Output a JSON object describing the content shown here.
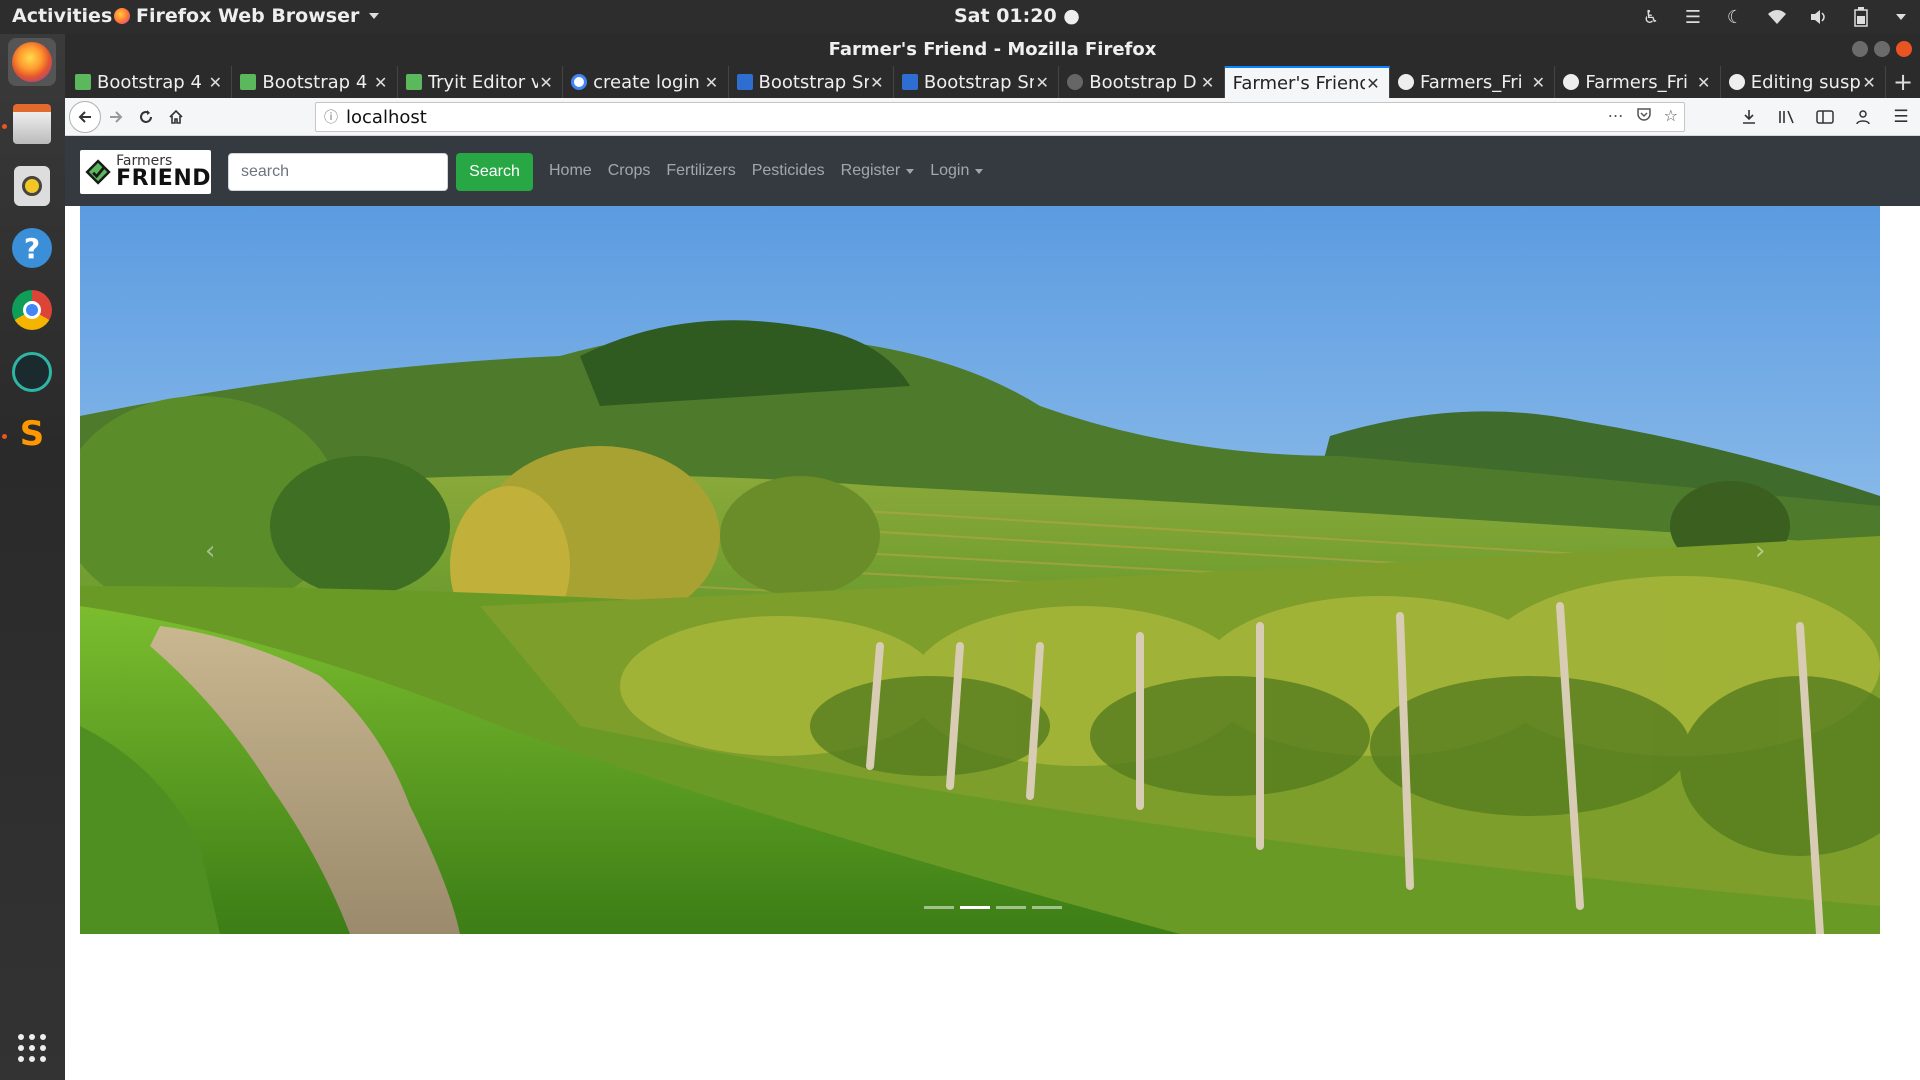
{
  "topbar": {
    "activities": "Activities",
    "app_menu": "Firefox Web Browser",
    "clock": "Sat 01:20",
    "tray_icons": [
      "accessibility-icon",
      "input-menu-icon",
      "night-light-icon",
      "wifi-icon",
      "volume-icon",
      "battery-icon"
    ]
  },
  "dock": {
    "items": [
      "firefox",
      "files",
      "rhythmbox",
      "help",
      "chrome",
      "gitkraken",
      "sublime-text"
    ],
    "apps_grid": "show-applications-icon"
  },
  "window": {
    "title": "Farmer's Friend - Mozilla Firefox"
  },
  "tabs": [
    {
      "title": "Bootstrap 4",
      "icon": "green"
    },
    {
      "title": "Bootstrap 4",
      "icon": "green"
    },
    {
      "title": "Tryit Editor v",
      "icon": "green"
    },
    {
      "title": "create login",
      "icon": "google"
    },
    {
      "title": "Bootstrap Sr",
      "icon": "blue"
    },
    {
      "title": "Bootstrap Sr",
      "icon": "blue"
    },
    {
      "title": "Bootstrap D",
      "icon": "gray"
    },
    {
      "title": "Farmer's Friend",
      "icon": "none",
      "active": true
    },
    {
      "title": "Farmers_Fri",
      "icon": "github"
    },
    {
      "title": "Farmers_Fri",
      "icon": "github"
    },
    {
      "title": "Editing susp",
      "icon": "github"
    }
  ],
  "urlbar": {
    "url": "localhost"
  },
  "site": {
    "brand_small": "Farmers",
    "brand_big": "FRIEND",
    "search_placeholder": "search",
    "search_button": "Search",
    "nav": {
      "home": "Home",
      "crops": "Crops",
      "fertilizers": "Fertilizers",
      "pesticides": "Pesticides",
      "register": "Register",
      "login": "Login"
    }
  },
  "carousel": {
    "slides_count": 4,
    "active_index": 1,
    "prev": "‹",
    "next": "›"
  },
  "colors": {
    "navbar_bg": "#343a40",
    "search_btn": "#28a745",
    "active_tab_accent": "#0a84ff",
    "ubuntu_orange": "#e95420"
  }
}
